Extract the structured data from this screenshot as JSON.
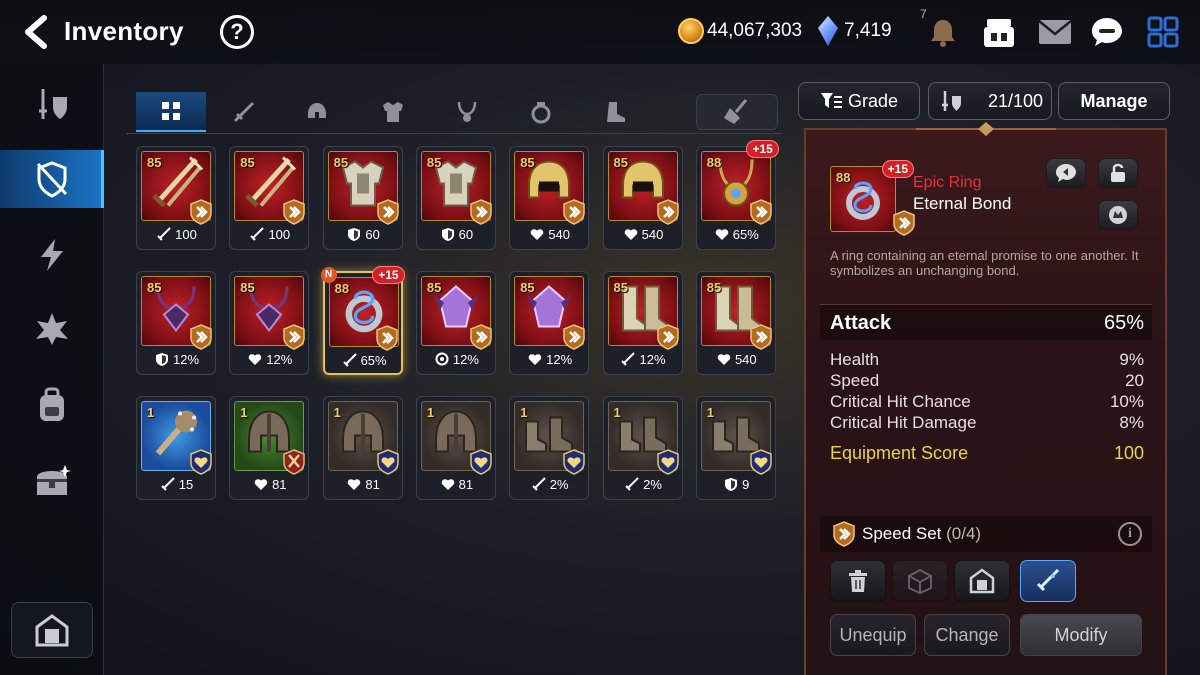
{
  "header": {
    "title": "Inventory",
    "help_label": "?",
    "gold": "44,067,303",
    "skystones": "7,419",
    "notification_count": "7"
  },
  "sidebar": {
    "items": [
      "gear-icon",
      "unequipped-gear-icon",
      "artifact-icon",
      "catalyst-icon",
      "material-icon",
      "chest-icon"
    ],
    "active_index": 1
  },
  "tabs": [
    "all",
    "weapon",
    "helmet",
    "armor",
    "necklace",
    "ring",
    "boots"
  ],
  "toolbar": {
    "sort_label": "Grade",
    "capacity": "21/100",
    "manage_label": "Manage"
  },
  "items": [
    {
      "lvl": "85",
      "grade": "red",
      "kind": "weapon",
      "set": "speed",
      "stat_icon": "attack",
      "stat": "100"
    },
    {
      "lvl": "85",
      "grade": "red",
      "kind": "weapon",
      "set": "speed",
      "stat_icon": "attack",
      "stat": "100"
    },
    {
      "lvl": "85",
      "grade": "red",
      "kind": "armor",
      "set": "speed",
      "stat_icon": "defense",
      "stat": "60"
    },
    {
      "lvl": "85",
      "grade": "red",
      "kind": "armor",
      "set": "speed",
      "stat_icon": "defense",
      "stat": "60"
    },
    {
      "lvl": "85",
      "grade": "red",
      "kind": "helmet",
      "set": "speed",
      "stat_icon": "health",
      "stat": "540"
    },
    {
      "lvl": "85",
      "grade": "red",
      "kind": "helmet",
      "set": "speed",
      "stat_icon": "health",
      "stat": "540"
    },
    {
      "lvl": "88",
      "grade": "red",
      "kind": "necklace",
      "set": "speed",
      "stat_icon": "health",
      "stat": "65%",
      "enh": "+15"
    },
    {
      "lvl": "85",
      "grade": "red",
      "kind": "necklace2",
      "set": "speed",
      "stat_icon": "defense",
      "stat": "12%"
    },
    {
      "lvl": "85",
      "grade": "red",
      "kind": "necklace2",
      "set": "speed",
      "stat_icon": "health",
      "stat": "12%"
    },
    {
      "lvl": "88",
      "grade": "red",
      "kind": "ring",
      "set": "speed",
      "stat_icon": "attack",
      "stat": "65%",
      "enh": "+15",
      "new": "N",
      "selected": true
    },
    {
      "lvl": "85",
      "grade": "red",
      "kind": "gem",
      "set": "speed",
      "stat_icon": "resist",
      "stat": "12%"
    },
    {
      "lvl": "85",
      "grade": "red",
      "kind": "gem",
      "set": "speed",
      "stat_icon": "health",
      "stat": "12%"
    },
    {
      "lvl": "85",
      "grade": "red",
      "kind": "boots",
      "set": "speed",
      "stat_icon": "attack",
      "stat": "12%"
    },
    {
      "lvl": "85",
      "grade": "red",
      "kind": "boots",
      "set": "speed",
      "stat_icon": "health",
      "stat": "540"
    },
    {
      "lvl": "1",
      "grade": "blue",
      "kind": "club",
      "set": "heart",
      "stat_icon": "attack",
      "stat": "15"
    },
    {
      "lvl": "1",
      "grade": "green",
      "kind": "helm",
      "set": "attack",
      "stat_icon": "health",
      "stat": "81"
    },
    {
      "lvl": "1",
      "grade": "grey",
      "kind": "helm",
      "set": "heart",
      "stat_icon": "health",
      "stat": "81"
    },
    {
      "lvl": "1",
      "grade": "grey",
      "kind": "helm",
      "set": "heart",
      "stat_icon": "health",
      "stat": "81"
    },
    {
      "lvl": "1",
      "grade": "grey",
      "kind": "shoe",
      "set": "heart",
      "stat_icon": "attack",
      "stat": "2%"
    },
    {
      "lvl": "1",
      "grade": "grey",
      "kind": "shoe",
      "set": "heart",
      "stat_icon": "attack",
      "stat": "2%"
    },
    {
      "lvl": "1",
      "grade": "grey",
      "kind": "shoe",
      "set": "heart",
      "stat_icon": "defense",
      "stat": "9"
    }
  ],
  "detail": {
    "level": "88",
    "enhance": "+15",
    "grade": "Epic Ring",
    "name": "Eternal Bond",
    "description": "A ring containing an eternal promise to one another. It symbolizes an unchanging bond.",
    "main_stat": {
      "label": "Attack",
      "value": "65%"
    },
    "substats": [
      {
        "label": "Health",
        "value": "9%"
      },
      {
        "label": "Speed",
        "value": "20"
      },
      {
        "label": "Critical Hit Chance",
        "value": "10%"
      },
      {
        "label": "Critical Hit Damage",
        "value": "8%"
      }
    ],
    "score": {
      "label": "Equipment Score",
      "value": "100"
    },
    "set_name": "Speed Set",
    "set_count": "(0/4)",
    "actions": {
      "unequip": "Unequip",
      "change": "Change",
      "modify": "Modify"
    }
  },
  "colors": {
    "accent_blue": "#1b74c7",
    "epic_red": "#e5333a",
    "score_yellow": "#f2d044",
    "selection_gold": "#e6c34a"
  }
}
